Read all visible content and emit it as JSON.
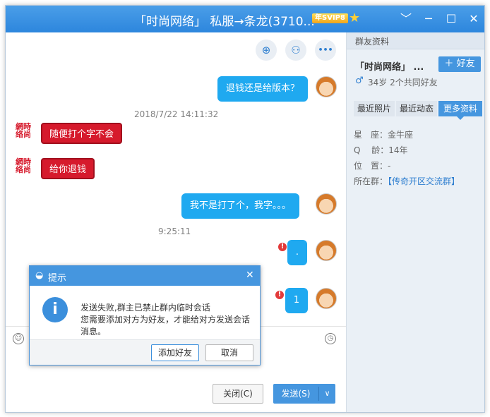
{
  "window": {
    "title": "「时尚网络」  私服→条龙(3710...",
    "vip_badge": "年SVIP8",
    "controls": [
      "﹀",
      "─",
      "☐",
      "✕"
    ]
  },
  "chat": {
    "actions": [
      {
        "icon": "add-contact-icon",
        "glyph": "⊕"
      },
      {
        "icon": "contact-info-icon",
        "glyph": "⚇"
      },
      {
        "icon": "more-icon",
        "glyph": "•••"
      }
    ],
    "messages": [
      {
        "sender": "me",
        "text": "退钱还是给版本？"
      },
      {
        "type": "time",
        "text": "2018/7/22 14:11:32"
      },
      {
        "sender": "other",
        "text": "随便打个字不会"
      },
      {
        "sender": "other",
        "text": "给你退钱"
      },
      {
        "sender": "me",
        "text": "我不是打了个，我字。。。"
      },
      {
        "type": "time",
        "text": "9:25:11"
      },
      {
        "sender": "me",
        "text": ".",
        "failed": true
      },
      {
        "sender": "me",
        "text": "1",
        "failed": true
      }
    ],
    "other_avatar_text": "網時络尚",
    "close_button": "关闭(C)",
    "send_button": "发送(S)",
    "send_dropdown": "∨"
  },
  "dialog": {
    "title": "提示",
    "message_line1": "发送失败,群主已禁止群内临时会话",
    "message_line2": "您需要添加对方为好友，才能给对方发送会话",
    "message_line3": "消息。",
    "add_friend_button": "添加好友",
    "cancel_button": "取消"
  },
  "side": {
    "header": "群友资料",
    "name": "「时尚网络」 ...",
    "add_friend": "好友",
    "profile_line": "34岁  2个共同好友",
    "tabs": [
      "最近照片",
      "最近动态",
      "更多资料"
    ],
    "active_tab": "更多资料",
    "fields": [
      {
        "label": "星　座：",
        "value": "金牛座"
      },
      {
        "label": "Q　 龄：",
        "value": "14年"
      },
      {
        "label": "位　置：",
        "value": "-"
      },
      {
        "label": "所在群：",
        "value": "【传奇开区交流群】"
      }
    ]
  },
  "colors": {
    "title_bar": "#2d86dd",
    "bubble_me": "#1fa9f0",
    "bubble_other": "#d61a2c",
    "link": "#2f7fd0"
  }
}
